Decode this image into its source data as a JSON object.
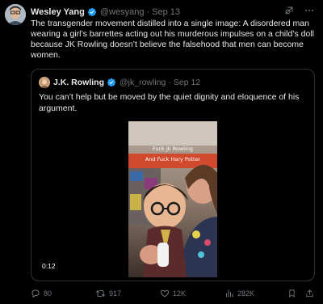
{
  "tweet": {
    "author_name": "Wesley Yang",
    "handle": "@wesyang",
    "date": "Sep 13",
    "text": "The transgender movement distilled into a single image: A disordered man wearing a girl’s barrettes acting out his murderous impulses on a child’s doll because JK Rowling doesn’t believe the falsehood that men can become women."
  },
  "quote": {
    "author_name": "J.K. Rowling",
    "handle": "@jk_rowling",
    "date": "Sep 12",
    "text": "You can’t help but be moved by the quiet dignity and eloquence of his argument.",
    "video": {
      "caption_line1": "Fuck Jk Rowling",
      "caption_line2": "And Fuck Hary Potter",
      "duration": "0:12"
    }
  },
  "actions": {
    "replies": "80",
    "reposts": "917",
    "likes": "12K",
    "views": "282K"
  },
  "colors": {
    "background": "#000000",
    "text": "#e7e9ea",
    "muted": "#71767b",
    "verified": "#1d9bf0",
    "border": "#2f3336"
  }
}
